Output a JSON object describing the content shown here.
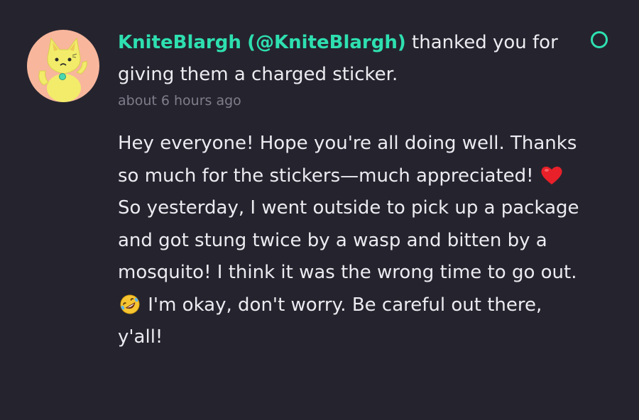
{
  "notification": {
    "user_name": "KniteBlargh",
    "user_handle": "(@KniteBlargh)",
    "action_text": " thanked you for giving them a charged sticker.",
    "timestamp": "about 6 hours ago",
    "message_part1": "Hey everyone! Hope you're all doing well. Thanks so much for the stickers—much appreciated! ",
    "emoji1": "red-heart",
    "message_part2": " So yesterday, I went outside to pick up a package and got stung twice by a wasp and bitten by a mosquito! I think it was the wrong time to go out. ",
    "emoji2": "rolling-on-floor-laughing",
    "message_part3": " I'm okay, don't worry. Be careful out there, y'all!",
    "unread_indicator": "unread-ring-icon"
  },
  "colors": {
    "background": "#25242e",
    "accent": "#2ee0b0",
    "text": "#ecebf1",
    "muted": "#7f7d8a",
    "avatar_bg": "#f8b69c"
  }
}
